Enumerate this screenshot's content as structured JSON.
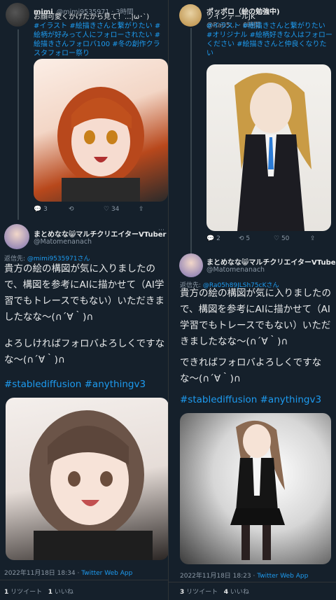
{
  "left": {
    "post1": {
      "name": "mimi",
      "handle": "@mimi9535971 · 3時間",
      "line1": "お顔可愛くかけたから見て！...|ω･`)",
      "tags": [
        "#イラスト",
        "#絵描きさんと繋がりたい",
        "#絵柄が好みって人にフォローされたい",
        "#絵描きさんフォロバ100",
        "#冬の創作クラスタフォロー祭り"
      ],
      "tags_text": "#イラスト #絵描きさんと繋がりたい #絵柄が好みって人にフォローされたい #絵描きさんフォロバ100 #冬の創作クラスタフォロー祭り",
      "stats": {
        "reply": "3",
        "retweet": "",
        "like": "34"
      }
    },
    "post2": {
      "name": "まとめなな😸マルチクリエイターVTuber",
      "handle": "@Matomenanach",
      "reply_to_label": "返信先: ",
      "reply_to": "@mimi9535971さん",
      "body1": "貴方の絵の構図が気に入りましたので、構図を参考にAIに描かせて（AI学習でもトレースでもない）いただきましたなな〜(∩´∀｀)∩",
      "body2": "よろしければフォロバよろしくですなな〜(∩´∀｀)∩",
      "hashtags": "#stablediffusion #anythingv3",
      "timestamp": "2022年11月18日 18:34 · ",
      "app": "Twitter Web App",
      "rt_count": "1",
      "rt_label": "リツイート",
      "like_count": "1",
      "like_label": "いいね"
    }
  },
  "right": {
    "post1": {
      "name": "ポッポロ（絵の勉強中)",
      "handle": "@Ra05... · 6時間",
      "line1": "ツインテールJK",
      "tags_text": "#イラスト #絵描きさんと繋がりたい #オリジナル #絵柄好きな人はフォローください #絵描きさんと仲良くなりたい",
      "stats": {
        "reply": "2",
        "retweet": "5",
        "like": "50"
      }
    },
    "post2": {
      "name": "まとめなな😸マルチクリエイターVTuber",
      "handle": "@Matomenanach",
      "reply_to_label": "返信先: ",
      "reply_to": "@Ra05h89JLSh75cKさん",
      "body1": "貴方の絵の構図が気に入りましたので、構図を参考にAIに描かせて（AI学習でもトレースでもない）いただきましたなな〜(∩´∀｀)∩",
      "body2": "できればフォロバよろしくですなな〜(∩´∀｀)∩",
      "hashtags": "#stablediffusion #anythingv3",
      "timestamp": "2022年11月18日 18:23 · ",
      "app": "Twitter Web App",
      "rt_count": "3",
      "rt_label": "リツイート",
      "like_count": "4",
      "like_label": "いいね"
    }
  },
  "colors": {
    "bg": "#15202b",
    "accent": "#1d9bf0",
    "muted": "#8b98a5"
  },
  "icons": [
    "reply-icon",
    "retweet-icon",
    "like-icon",
    "share-icon",
    "more-icon"
  ]
}
